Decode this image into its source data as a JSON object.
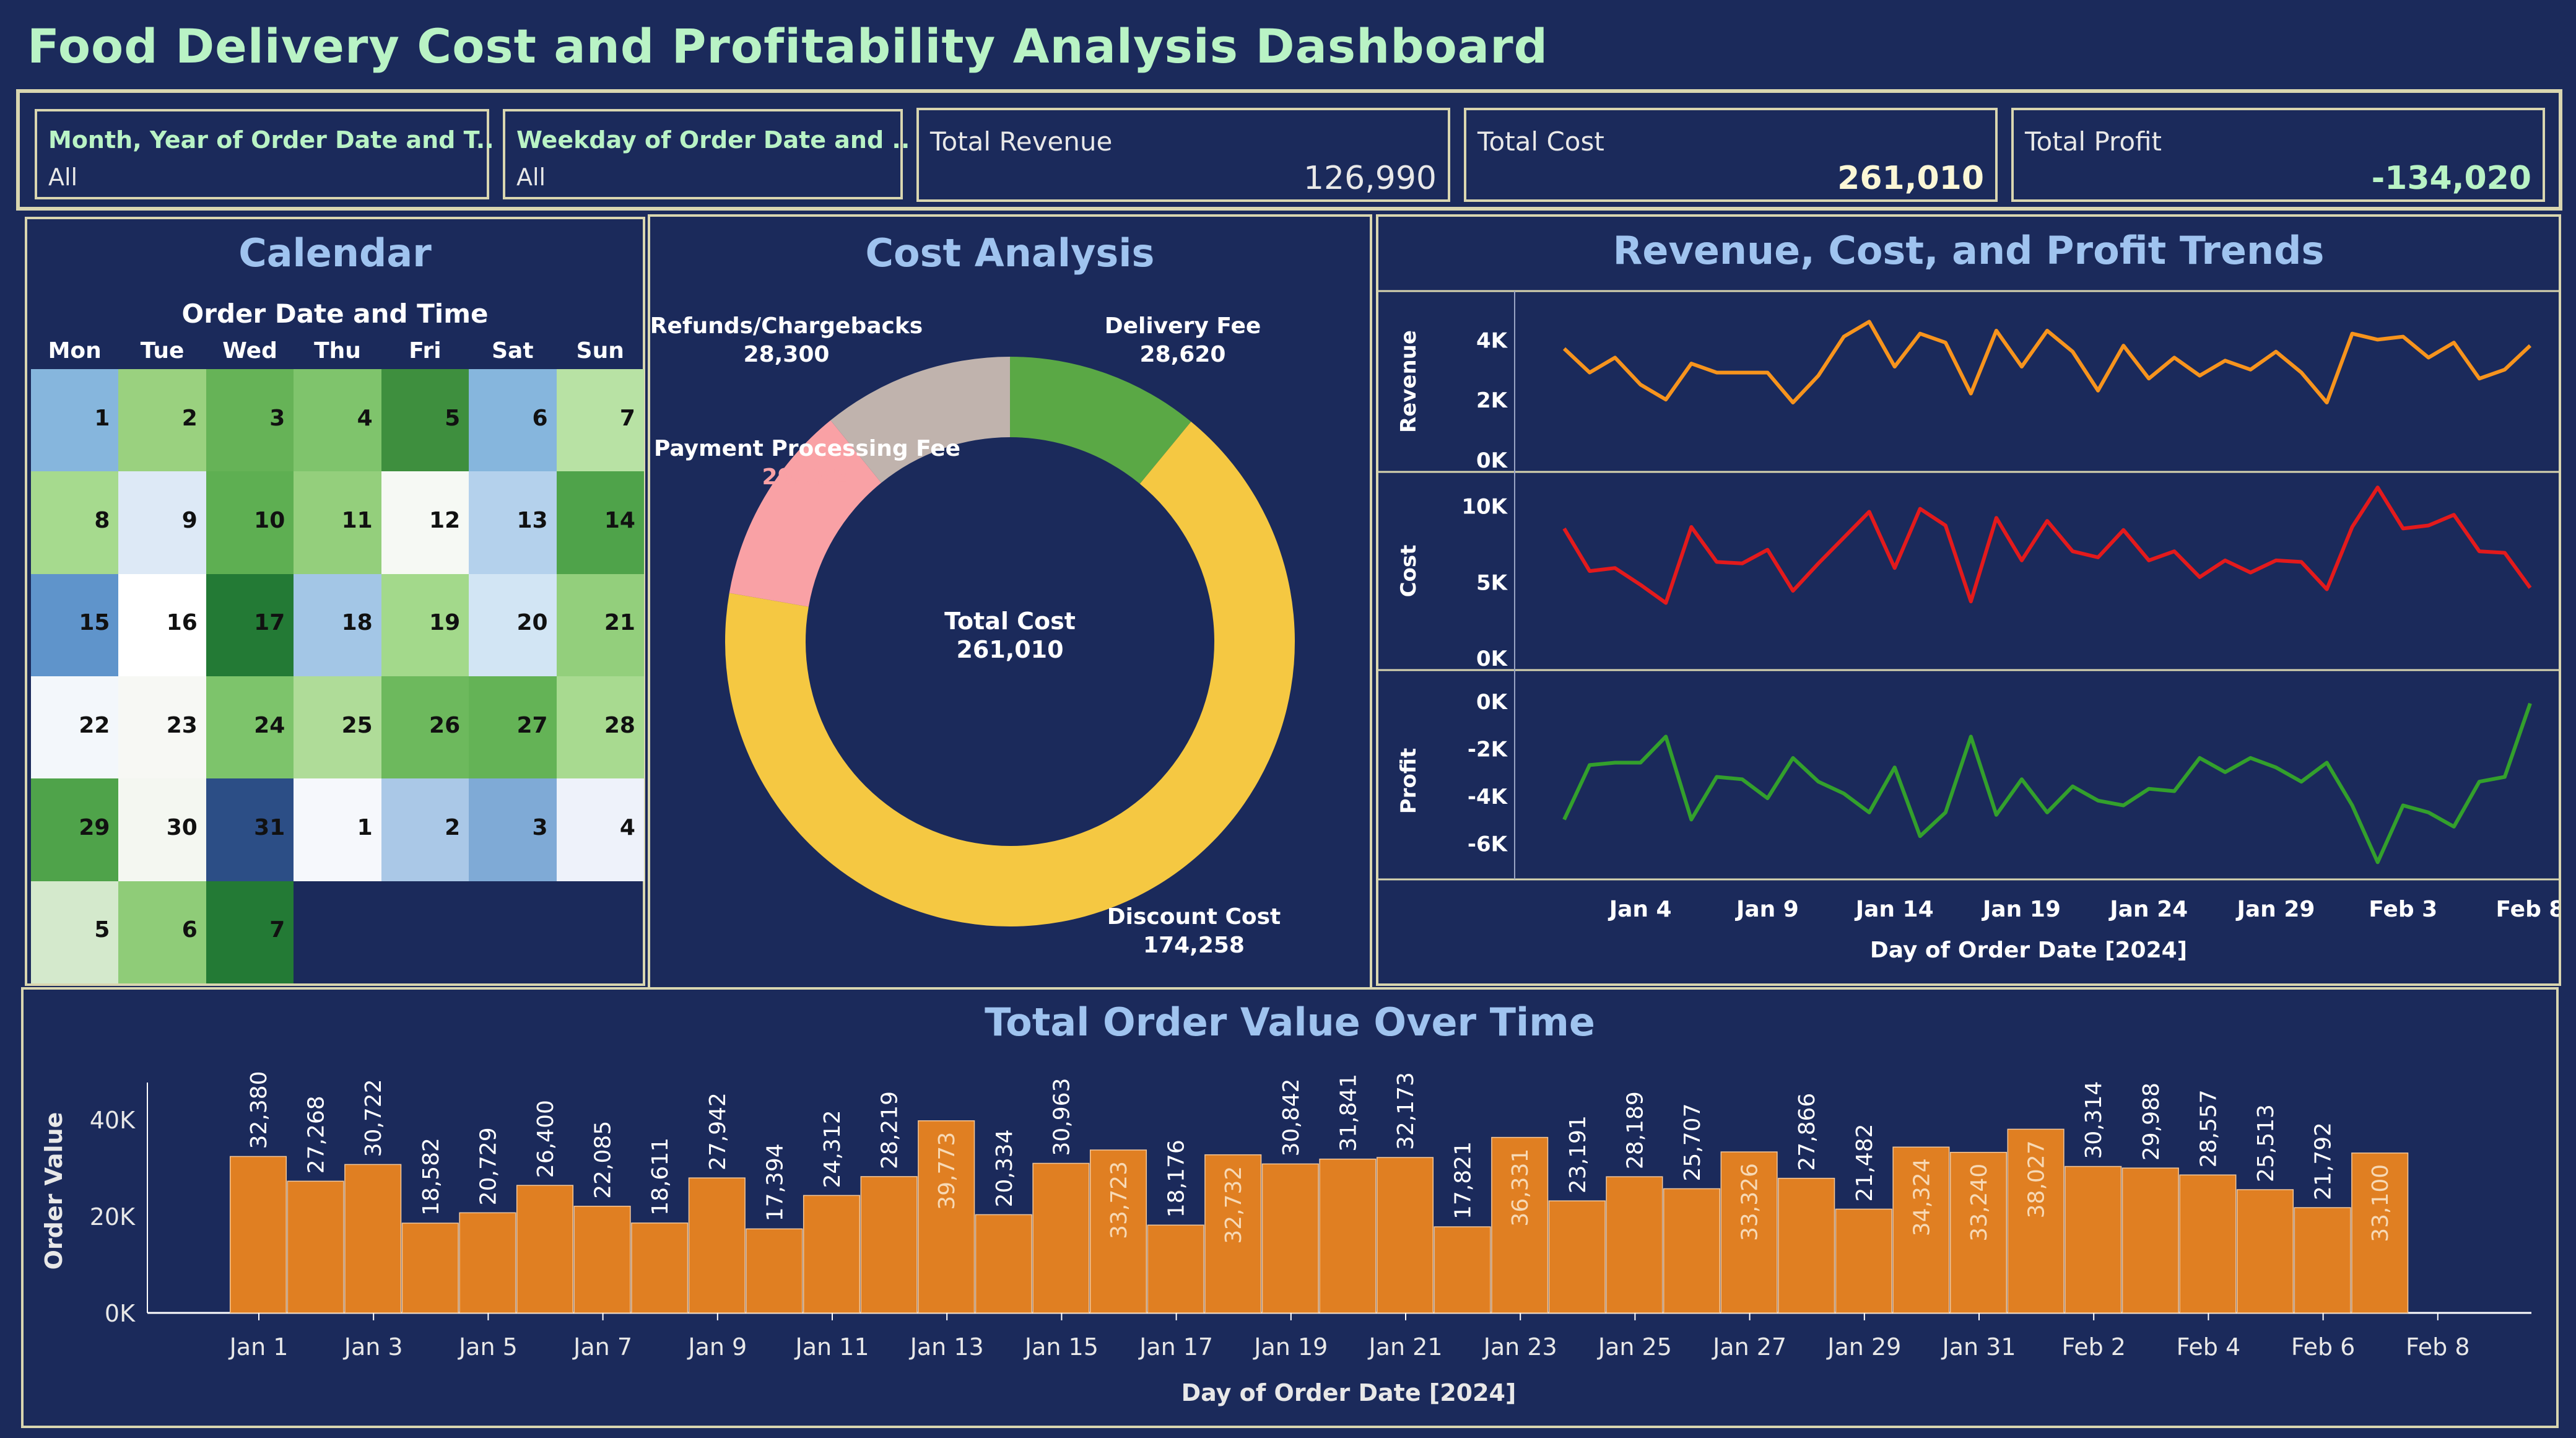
{
  "title": "Food Delivery Cost and Profitability Analysis Dashboard",
  "filters": [
    {
      "label": "Month, Year of Order Date and T..",
      "value": "All"
    },
    {
      "label": "Weekday of Order Date and ..",
      "value": "All"
    }
  ],
  "kpis": [
    {
      "label": "Total Revenue",
      "value": "126,990"
    },
    {
      "label": "Total Cost",
      "value": "261,010"
    },
    {
      "label": "Total Profit",
      "value": "-134,020"
    }
  ],
  "calendar": {
    "title": "Calendar",
    "subtitle": "Order Date and Time",
    "weekdays": [
      "Mon",
      "Tue",
      "Wed",
      "Thu",
      "Fri",
      "Sat",
      "Sun"
    ],
    "weeks": [
      [
        {
          "d": "1",
          "c": "#86b6dd"
        },
        {
          "d": "2",
          "c": "#9ad17f"
        },
        {
          "d": "3",
          "c": "#66b357"
        },
        {
          "d": "4",
          "c": "#7fc46c"
        },
        {
          "d": "5",
          "c": "#3e8f3e"
        },
        {
          "d": "6",
          "c": "#86b6dd"
        },
        {
          "d": "7",
          "c": "#b8e2a4"
        }
      ],
      [
        {
          "d": "8",
          "c": "#a6da8e"
        },
        {
          "d": "9",
          "c": "#dde9f6"
        },
        {
          "d": "10",
          "c": "#5eaf52"
        },
        {
          "d": "11",
          "c": "#94cf7c"
        },
        {
          "d": "12",
          "c": "#f6f9f4"
        },
        {
          "d": "13",
          "c": "#b4d1ec"
        },
        {
          "d": "14",
          "c": "#4fa34a"
        }
      ],
      [
        {
          "d": "15",
          "c": "#5f94cb"
        },
        {
          "d": "16",
          "c": "#ffffff"
        },
        {
          "d": "17",
          "c": "#237a35"
        },
        {
          "d": "18",
          "c": "#a3c6e6"
        },
        {
          "d": "19",
          "c": "#a3d98b"
        },
        {
          "d": "20",
          "c": "#d2e5f4"
        },
        {
          "d": "21",
          "c": "#93cf7c"
        }
      ],
      [
        {
          "d": "22",
          "c": "#f3f7fb"
        },
        {
          "d": "23",
          "c": "#f7f8f4"
        },
        {
          "d": "24",
          "c": "#7dc46b"
        },
        {
          "d": "25",
          "c": "#afdc98"
        },
        {
          "d": "26",
          "c": "#6db95d"
        },
        {
          "d": "27",
          "c": "#64b356"
        },
        {
          "d": "28",
          "c": "#a8da90"
        }
      ],
      [
        {
          "d": "29",
          "c": "#4fa34a"
        },
        {
          "d": "30",
          "c": "#f4f7f1"
        },
        {
          "d": "31",
          "c": "#2c4e86"
        },
        {
          "d": "1",
          "c": "#f6f8fc"
        },
        {
          "d": "2",
          "c": "#aac8e7"
        },
        {
          "d": "3",
          "c": "#7faad6"
        },
        {
          "d": "4",
          "c": "#eef2fa"
        }
      ],
      [
        {
          "d": "5",
          "c": "#d4e9cc"
        },
        {
          "d": "6",
          "c": "#8fcc78"
        },
        {
          "d": "7",
          "c": "#237a35"
        }
      ]
    ]
  },
  "cost_analysis": {
    "title": "Cost Analysis",
    "center_label": "Total Cost",
    "center_value": "261,010"
  },
  "trends": {
    "title": "Revenue, Cost, and Profit Trends",
    "xlabel": "Day of Order Date  [2024]",
    "x_ticks": [
      "Jan 4",
      "Jan 9",
      "Jan 14",
      "Jan 19",
      "Jan 24",
      "Jan 29",
      "Feb 3",
      "Feb 8"
    ],
    "panels": [
      {
        "ylabel": "Revenue",
        "ticks": [
          "4K",
          "2K",
          "0K"
        ]
      },
      {
        "ylabel": "Cost",
        "ticks": [
          "10K",
          "5K",
          "0K"
        ]
      },
      {
        "ylabel": "Profit",
        "ticks": [
          "0K",
          "-2K",
          "-4K",
          "-6K"
        ]
      }
    ]
  },
  "orders": {
    "title": "Total Order Value Over Time",
    "xlabel": "Day of Order Date [2024]",
    "ylabel": "Order Value",
    "y_ticks": [
      "40K",
      "20K",
      "0K"
    ],
    "x_ticks": [
      "Jan 1",
      "Jan 3",
      "Jan 5",
      "Jan 7",
      "Jan 9",
      "Jan 11",
      "Jan 13",
      "Jan 15",
      "Jan 17",
      "Jan 19",
      "Jan 21",
      "Jan 23",
      "Jan 25",
      "Jan 27",
      "Jan 29",
      "Jan 31",
      "Feb 2",
      "Feb 4",
      "Feb 6",
      "Feb 8"
    ]
  },
  "colors": {
    "background": "#1b2a5b",
    "frame": "#d9d6b0",
    "title": "#b9f3c5",
    "panel_title": "#9fc3ef",
    "revenue": "#f7941d",
    "cost": "#e31a1c",
    "profit": "#33a02c",
    "bar": "#e07f22"
  },
  "chart_data": [
    {
      "type": "pie",
      "title": "Cost Analysis",
      "categories": [
        "Delivery Fee",
        "Discount Cost",
        "Payment Processing Fee",
        "Refunds/Chargebacks"
      ],
      "labels": [
        "28,620",
        "174,258",
        "29,832",
        "28,300"
      ],
      "values": [
        28620,
        174258,
        29832,
        28300
      ],
      "colors": [
        "#5aa845",
        "#f5c842",
        "#f9a1a5",
        "#c0b3ad"
      ]
    },
    {
      "type": "line",
      "title": "Revenue, Cost, and Profit Trends",
      "xlabel": "Day of Order Date  [2024]",
      "x": [
        "Jan 1",
        "Jan 2",
        "Jan 3",
        "Jan 4",
        "Jan 5",
        "Jan 6",
        "Jan 7",
        "Jan 8",
        "Jan 9",
        "Jan 10",
        "Jan 11",
        "Jan 12",
        "Jan 13",
        "Jan 14",
        "Jan 15",
        "Jan 16",
        "Jan 17",
        "Jan 18",
        "Jan 19",
        "Jan 20",
        "Jan 21",
        "Jan 22",
        "Jan 23",
        "Jan 24",
        "Jan 25",
        "Jan 26",
        "Jan 27",
        "Jan 28",
        "Jan 29",
        "Jan 30",
        "Jan 31",
        "Feb 1",
        "Feb 2",
        "Feb 3",
        "Feb 4",
        "Feb 5",
        "Feb 6",
        "Feb 7",
        "Feb 8"
      ],
      "series": [
        {
          "name": "Revenue",
          "ylim": [
            0,
            5000
          ],
          "values": [
            3700,
            2900,
            3400,
            2500,
            2000,
            3200,
            2900,
            2900,
            2900,
            1900,
            2800,
            4100,
            4600,
            3100,
            4200,
            3900,
            2200,
            4300,
            3100,
            4300,
            3600,
            2300,
            3800,
            2700,
            3400,
            2800,
            3300,
            3000,
            3600,
            2900,
            1900,
            4200,
            4000,
            4100,
            3400,
            3900,
            2700,
            3000,
            3800
          ]
        },
        {
          "name": "Cost",
          "ylim": [
            0,
            11000
          ],
          "values": [
            8500,
            5700,
            5900,
            4800,
            3600,
            8600,
            6300,
            6200,
            7100,
            4400,
            6200,
            7900,
            9600,
            5900,
            9800,
            8700,
            3700,
            9200,
            6400,
            9000,
            7000,
            6600,
            8400,
            6400,
            7000,
            5300,
            6400,
            5600,
            6400,
            6300,
            4500,
            8600,
            11200,
            8500,
            8700,
            9400,
            7000,
            6900,
            4600
          ]
        },
        {
          "name": "Profit",
          "ylim": [
            -7000,
            0
          ],
          "values": [
            -5000,
            -2700,
            -2600,
            -2600,
            -1500,
            -5000,
            -3200,
            -3300,
            -4100,
            -2400,
            -3400,
            -3900,
            -4700,
            -2800,
            -5700,
            -4700,
            -1500,
            -4800,
            -3300,
            -4700,
            -3600,
            -4200,
            -4400,
            -3700,
            -3800,
            -2400,
            -3000,
            -2400,
            -2800,
            -3400,
            -2600,
            -4400,
            -6800,
            -4400,
            -4700,
            -5300,
            -3400,
            -3200,
            -100
          ]
        }
      ]
    },
    {
      "type": "bar",
      "title": "Total Order Value Over Time",
      "xlabel": "Day of Order Date [2024]",
      "ylabel": "Order Value",
      "ylim": [
        0,
        50000
      ],
      "categories": [
        "Jan 1",
        "Jan 2",
        "Jan 3",
        "Jan 4",
        "Jan 5",
        "Jan 6",
        "Jan 7",
        "Jan 8",
        "Jan 9",
        "Jan 10",
        "Jan 11",
        "Jan 12",
        "Jan 13",
        "Jan 14",
        "Jan 15",
        "Jan 16",
        "Jan 17",
        "Jan 18",
        "Jan 19",
        "Jan 20",
        "Jan 21",
        "Jan 22",
        "Jan 23",
        "Jan 24",
        "Jan 25",
        "Jan 26",
        "Jan 27",
        "Jan 28",
        "Jan 29",
        "Jan 30",
        "Jan 31",
        "Feb 1",
        "Feb 2",
        "Feb 3",
        "Feb 4",
        "Feb 5",
        "Feb 6",
        "Feb 7",
        "Feb 8"
      ],
      "values": [
        32380,
        27268,
        30722,
        18582,
        20729,
        26400,
        22085,
        18611,
        27942,
        17394,
        24312,
        28219,
        39773,
        20334,
        30963,
        33723,
        18176,
        32732,
        30842,
        31841,
        32173,
        17821,
        36331,
        23191,
        28189,
        25707,
        33326,
        27866,
        21482,
        34324,
        33240,
        38027,
        30314,
        29988,
        28557,
        25513,
        21792,
        33100
      ],
      "labels": [
        "32,380",
        "27,268",
        "30,722",
        "18,582",
        "20,729",
        "26,400",
        "22,085",
        "18,611",
        "27,942",
        "17,394",
        "24,312",
        "28,219",
        "39,773",
        "20,334",
        "30,963",
        "33,723",
        "18,176",
        "32,732",
        "30,842",
        "31,841",
        "32,173",
        "17,821",
        "36,331",
        "23,191",
        "28,189",
        "25,707",
        "33,326",
        "27,866",
        "21,482",
        "34,324",
        "33,240",
        "38,027",
        "30,314",
        "29,988",
        "28,557",
        "25,513",
        "21,792",
        "33,100"
      ],
      "inside_labels": [
        12,
        15,
        17,
        22,
        26,
        29,
        30,
        31,
        37
      ]
    }
  ]
}
